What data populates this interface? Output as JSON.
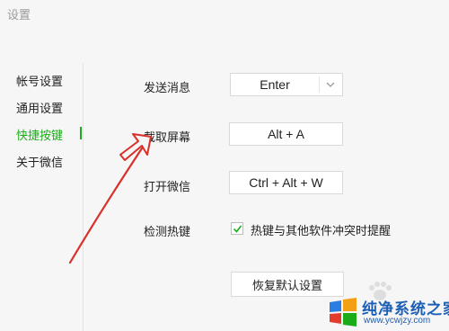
{
  "window": {
    "title": "设置"
  },
  "sidebar": {
    "items": [
      {
        "label": "帐号设置",
        "active": false
      },
      {
        "label": "通用设置",
        "active": false
      },
      {
        "label": "快捷按键",
        "active": true
      },
      {
        "label": "关于微信",
        "active": false
      }
    ]
  },
  "shortcuts": {
    "send": {
      "label": "发送消息",
      "value": "Enter",
      "icon": "chevron-down-icon"
    },
    "screenshot": {
      "label": "截取屏幕",
      "value": "Alt + A"
    },
    "open": {
      "label": "打开微信",
      "value": "Ctrl + Alt + W"
    },
    "hotkey_detect": {
      "label": "检测热键",
      "checkbox_label": "热键与其他软件冲突时提醒",
      "checked": true
    },
    "reset_label": "恢复默认设置"
  },
  "colors": {
    "accent": "#1aad19",
    "annotation": "#d9302a",
    "watermark": "#1d5fb4"
  },
  "watermark": {
    "title": "纯净系统之家",
    "url": "www.ycwjzy.com"
  }
}
